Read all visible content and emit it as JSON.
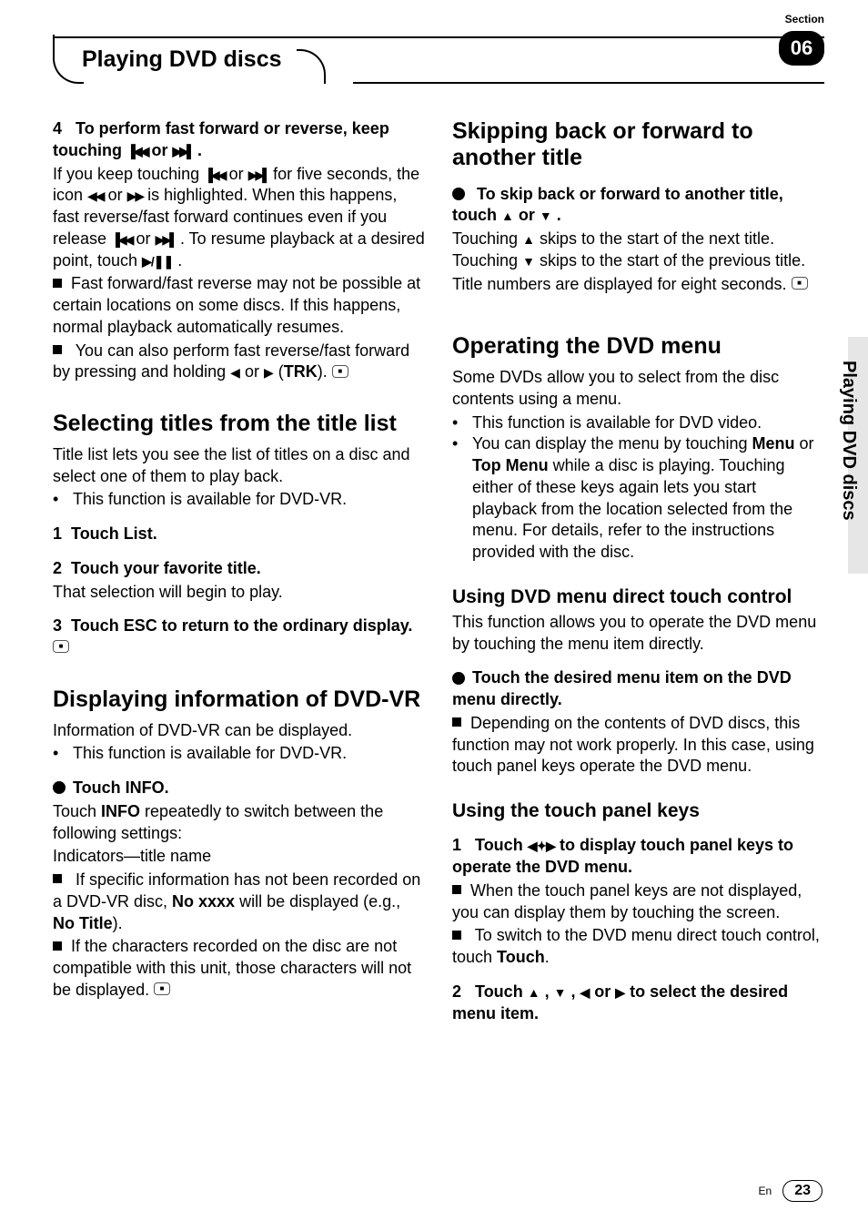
{
  "header": {
    "section_label": "Section",
    "section_number": "06",
    "chapter_title": "Playing DVD discs"
  },
  "side_tab": "Playing DVD discs",
  "footer": {
    "lang": "En",
    "page": "23"
  },
  "left": {
    "step4": {
      "head_a": "4",
      "head_b": "To perform fast forward or reverse, keep touching ",
      "head_c": " or ",
      "head_d": ".",
      "p1a": "If you keep touching ",
      "p1b": " or ",
      "p1c": " for five seconds, the icon ",
      "p1d": " or ",
      "p1e": " is highlighted. When this happens, fast reverse/fast forward continues even if you release ",
      "p1f": " or ",
      "p1g": ". To resume playback at a desired point, touch ",
      "p1h": ".",
      "note1": "Fast forward/fast reverse may not be possible at certain locations on some discs. If this happens, normal playback automatically resumes.",
      "note2a": "You can also perform fast reverse/fast forward by pressing and holding ",
      "note2b": " or ",
      "note2c": " (",
      "note2d": "TRK",
      "note2e": ")."
    },
    "titles": {
      "h": "Selecting titles from the title list",
      "intro": "Title list lets you see the list of titles on a disc and select one of them to play back.",
      "bul1": "This function is available for DVD-VR.",
      "s1n": "1",
      "s1": "Touch List.",
      "s2n": "2",
      "s2": "Touch your favorite title.",
      "s2b": "That selection will begin to play.",
      "s3n": "3",
      "s3": "Touch ESC to return to the ordinary display."
    },
    "info": {
      "h": "Displaying information of DVD-VR",
      "intro": "Information of DVD-VR can be displayed.",
      "bul1": "This function is available for DVD-VR.",
      "action": "Touch INFO.",
      "p1a": "Touch ",
      "p1b": "INFO",
      "p1c": " repeatedly to switch between the following settings:",
      "p2": "Indicators—title name",
      "n1a": "If specific information has not been recorded on a DVD-VR disc, ",
      "n1b": "No xxxx",
      "n1c": " will be displayed (e.g., ",
      "n1d": "No Title",
      "n1e": ").",
      "n2": "If the characters recorded on the disc are not compatible with this unit, those characters will not be displayed."
    }
  },
  "right": {
    "skip": {
      "h": "Skipping back or forward to another title",
      "action_a": "To skip back or forward to another title, touch ",
      "action_b": " or ",
      "action_c": ".",
      "p1a": "Touching ",
      "p1b": " skips to the start of the next title. Touching ",
      "p1c": " skips to the start of the previous title.",
      "p2": "Title numbers are displayed for eight seconds."
    },
    "menu": {
      "h": "Operating the DVD menu",
      "intro": "Some DVDs allow you to select from the disc contents using a menu.",
      "b1": "This function is available for DVD video.",
      "b2a": "You can display the menu by touching ",
      "b2b": "Menu",
      "b2c": " or ",
      "b2d": "Top Menu",
      "b2e": " while a disc is playing. Touching either of these keys again lets you start playback from the location selected from the menu. For details, refer to the instructions provided with the disc."
    },
    "direct": {
      "h": "Using DVD menu direct touch control",
      "intro": "This function allows you to operate the DVD menu by touching the menu item directly.",
      "action": "Touch the desired menu item on the DVD menu directly.",
      "note": "Depending on the contents of DVD discs, this function may not work properly. In this case, using touch panel keys operate the DVD menu."
    },
    "panel": {
      "h": "Using the touch panel keys",
      "s1n": "1",
      "s1a": "Touch ",
      "s1b": " to display touch panel keys to operate the DVD menu.",
      "n1": "When the touch panel keys are not displayed, you can display them by touching the screen.",
      "n2a": "To switch to the DVD menu direct touch control, touch ",
      "n2b": "Touch",
      "n2c": ".",
      "s2n": "2",
      "s2a": "Touch ",
      "s2b": ", ",
      "s2c": ", ",
      "s2d": " or ",
      "s2e": " to select the desired menu item."
    }
  }
}
